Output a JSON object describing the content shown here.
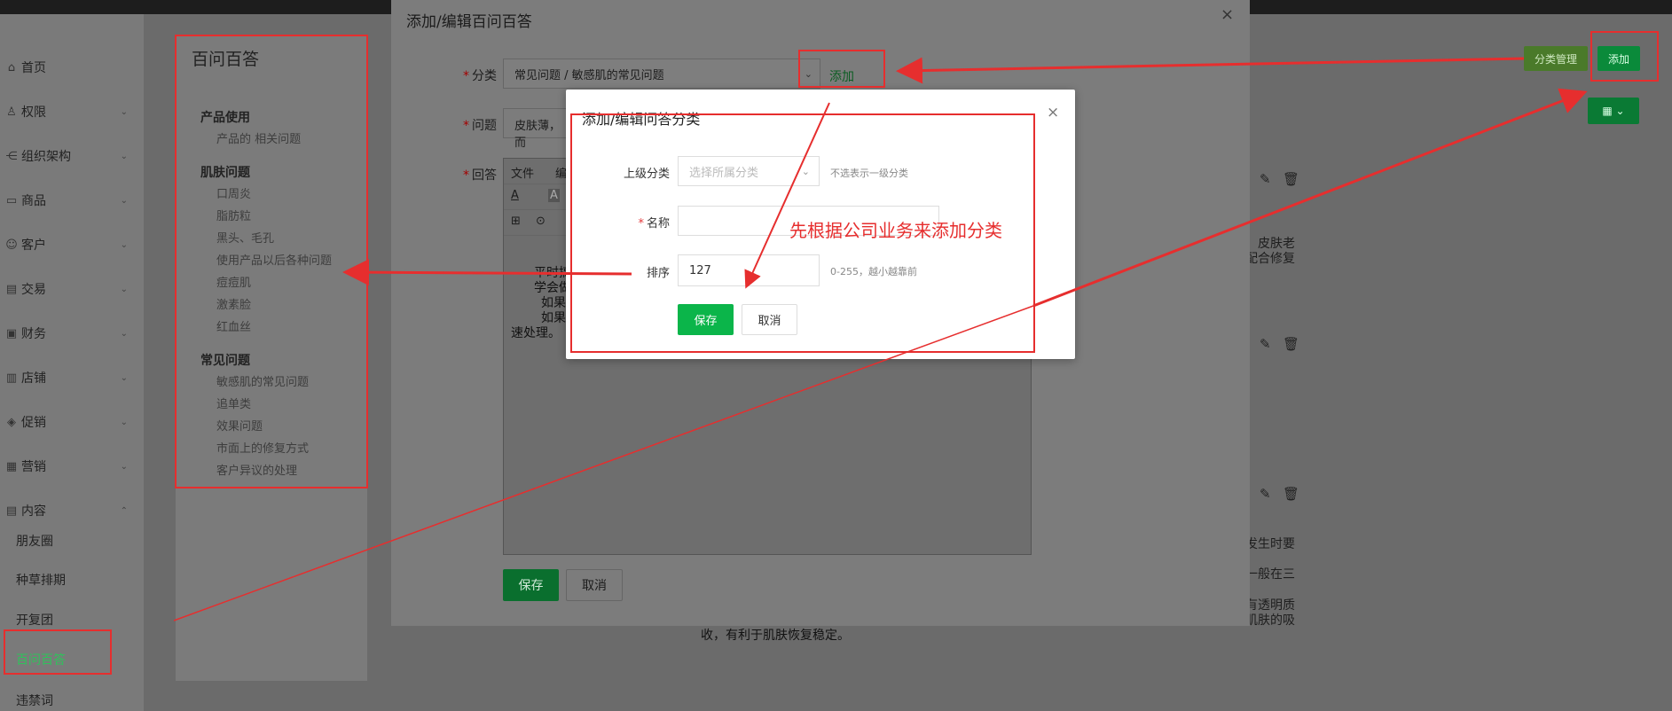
{
  "sidebar": {
    "items": [
      {
        "icon": "home-icon",
        "glyph": "⌂",
        "label": "首页",
        "chevron": ""
      },
      {
        "icon": "permission-icon",
        "glyph": "♙",
        "label": "权限",
        "chevron": "⌄"
      },
      {
        "icon": "org-icon",
        "glyph": "⋲",
        "label": "组织架构",
        "chevron": "⌄"
      },
      {
        "icon": "goods-icon",
        "glyph": "▭",
        "label": "商品",
        "chevron": "⌄"
      },
      {
        "icon": "customer-icon",
        "glyph": "☺",
        "label": "客户",
        "chevron": "⌄"
      },
      {
        "icon": "trade-icon",
        "glyph": "▤",
        "label": "交易",
        "chevron": "⌄"
      },
      {
        "icon": "finance-icon",
        "glyph": "▣",
        "label": "财务",
        "chevron": "⌄"
      },
      {
        "icon": "shop-icon",
        "glyph": "▥",
        "label": "店铺",
        "chevron": "⌄"
      },
      {
        "icon": "promotion-icon",
        "glyph": "◈",
        "label": "促销",
        "chevron": "⌄"
      },
      {
        "icon": "marketing-icon",
        "glyph": "▦",
        "label": "营销",
        "chevron": "⌄"
      },
      {
        "icon": "content-icon",
        "glyph": "▤",
        "label": "内容",
        "chevron": "⌃"
      }
    ],
    "sub_items": [
      "朋友圈",
      "种草排期",
      "开复团",
      "百问百答",
      "违禁词"
    ],
    "active_sub": "百问百答"
  },
  "panel": {
    "title": "百问百答",
    "groups": [
      {
        "name": "产品使用",
        "items": [
          "产品的 相关问题"
        ]
      },
      {
        "name": "肌肤问题",
        "items": [
          "口周炎",
          "脂肪粒",
          "黑头、毛孔",
          "使用产品以后各种问题",
          "痘痘肌",
          "激素脸",
          "红血丝"
        ]
      },
      {
        "name": "常见问题",
        "items": [
          "敏感肌的常见问题",
          "追单类",
          "效果问题",
          "市面上的修复方式",
          "客户异议的处理"
        ]
      }
    ]
  },
  "toolbar": {
    "category_manage": "分类管理",
    "add": "添加",
    "grid_view": "▦ ⌄"
  },
  "right_text": {
    "line1": "皮肤老",
    "line2": "配合修复",
    "line3": "发生时要",
    "line4": "一般在三",
    "line5": "有透明质",
    "line6": "肌肤的吸"
  },
  "modal_main": {
    "title": "添加/编辑百问百答",
    "category_label": "分类",
    "category_value": "常见问题 / 敏感肌的常见问题",
    "add_link": "添加",
    "question_label": "问题",
    "question_value": "皮肤薄，而",
    "answer_label": "回答",
    "editor_menu": [
      "文件",
      "编"
    ],
    "editor_lines": [
      "平时搞",
      "学会做",
      "如果",
      "如果",
      "速处理。"
    ],
    "save": "保存",
    "cancel": "取消",
    "bottom_text": "收，有利于肌肤恢复稳定。"
  },
  "modal_category": {
    "title": "添加/编辑问答分类",
    "parent_label": "上级分类",
    "parent_placeholder": "选择所属分类",
    "parent_hint": "不选表示一级分类",
    "name_label": "名称",
    "sort_label": "排序",
    "sort_value": "127",
    "sort_hint": "0-255，越小越靠前",
    "save": "保存",
    "cancel": "取消"
  },
  "annotation": {
    "note": "先根据公司业务来添加分类"
  },
  "colors": {
    "accent_green": "#0bb54a",
    "annotation_red": "#e62e2e"
  }
}
